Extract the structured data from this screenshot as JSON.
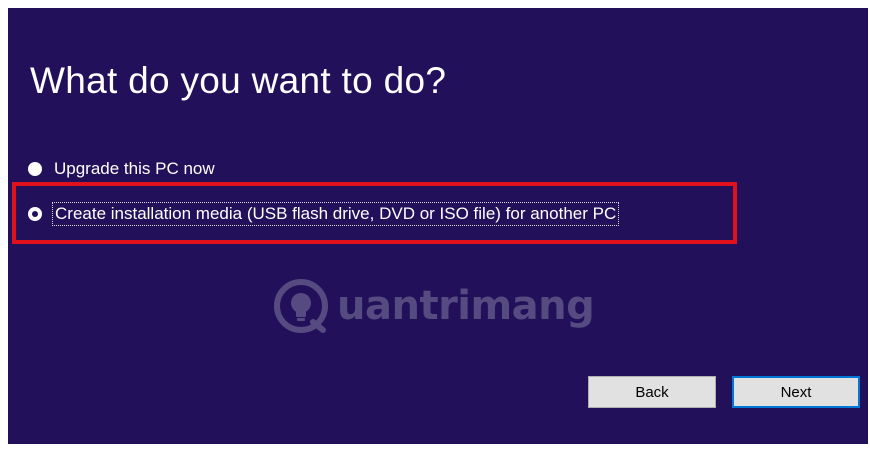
{
  "page": {
    "title": "What do you want to do?"
  },
  "options": [
    {
      "label": "Upgrade this PC now",
      "selected": false
    },
    {
      "label": "Create installation media (USB flash drive, DVD or ISO file) for another PC",
      "selected": true
    }
  ],
  "watermark": {
    "text": "uantrimang",
    "logo_icon": "lightbulb-q-logo-icon"
  },
  "buttons": {
    "back_label": "Back",
    "next_label": "Next"
  },
  "colors": {
    "background": "#22105a",
    "highlight_border": "#e0101c",
    "button_face": "#e1e1e1",
    "default_button_border": "#0078d7"
  }
}
